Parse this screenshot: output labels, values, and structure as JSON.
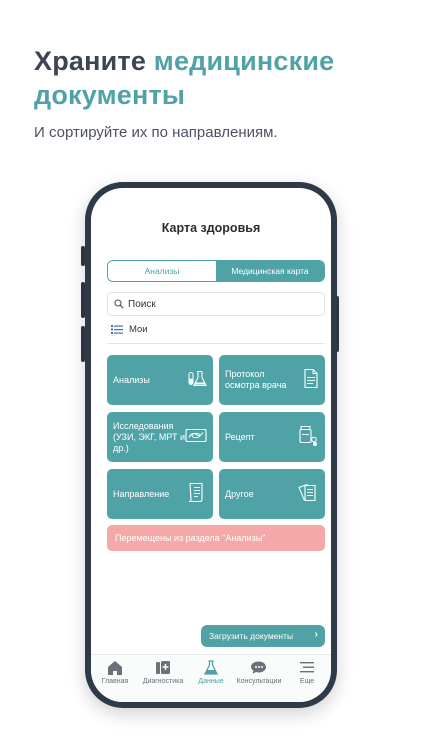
{
  "promo": {
    "title_part1": "Храните ",
    "title_part2": "медицинские документы",
    "subtitle": "И сортируйте их по направлениям."
  },
  "screen": {
    "title": "Карта здоровья",
    "segments": [
      "Анализы",
      "Медицинская карта"
    ],
    "search_placeholder": "Поиск",
    "filter_label": "Мои",
    "tiles": [
      {
        "label": "Анализы",
        "icon": "flask-icon"
      },
      {
        "label": "Протокол осмотра врача",
        "icon": "document-icon"
      },
      {
        "label": "Исследования (УЗИ, ЭКГ, МРТ и др.)",
        "icon": "scan-icon"
      },
      {
        "label": "Рецепт",
        "icon": "pills-icon"
      },
      {
        "label": "Направление",
        "icon": "referral-icon"
      },
      {
        "label": "Другое",
        "icon": "documents-icon"
      }
    ],
    "banner": "Перемещены из раздела \"Анализы\"",
    "upload_button": "Загрузить документы"
  },
  "tabbar": {
    "items": [
      {
        "label": "Главная",
        "icon": "home-icon",
        "active": false
      },
      {
        "label": "Диагностика",
        "icon": "diagnostics-icon",
        "active": false
      },
      {
        "label": "Данные",
        "icon": "flask-icon",
        "active": true
      },
      {
        "label": "Консультации",
        "icon": "chat-icon",
        "active": false
      },
      {
        "label": "Еще",
        "icon": "menu-icon",
        "active": false
      }
    ]
  },
  "colors": {
    "accent": "#4fa3a6",
    "heading": "#3d4453",
    "banner": "#f4a9a8",
    "phone_frame": "#2f3a48"
  }
}
